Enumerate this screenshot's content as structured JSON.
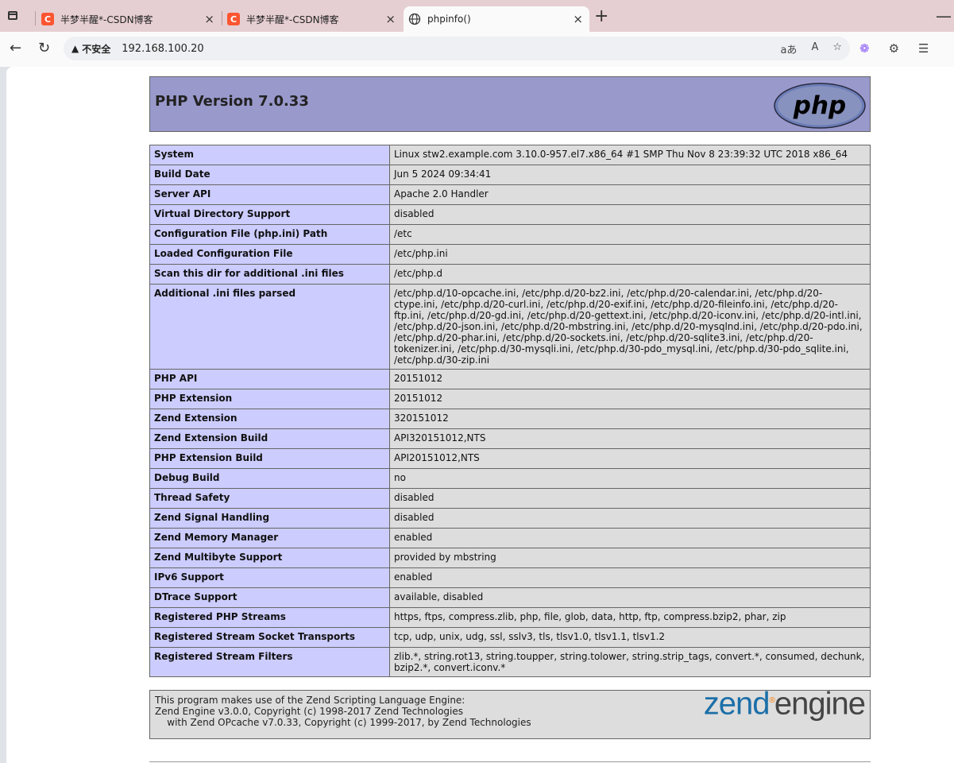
{
  "browser": {
    "tabs": [
      {
        "label": "半梦半醒*-CSDN博客",
        "icon": "csdn-icon",
        "favicon_text": "C",
        "active": false
      },
      {
        "label": "半梦半醒*-CSDN博客",
        "icon": "csdn-icon",
        "favicon_text": "C",
        "active": false
      },
      {
        "label": "phpinfo()",
        "icon": "globe-icon",
        "active": true
      }
    ],
    "address": {
      "security_label": "不安全",
      "url": "192.168.100.20"
    },
    "icons": {
      "back": "←",
      "refresh": "↻",
      "new_tab": "+",
      "close": "×",
      "minimize": "—",
      "read_aloud": "aあ",
      "reader": "A",
      "favorite": "☆",
      "copilot": "❁",
      "extensions": "⚙",
      "favorites_bar": "☰"
    }
  },
  "phpinfo": {
    "title": "PHP Version 7.0.33",
    "logo_text": "php",
    "rows": [
      {
        "key": "System",
        "value": "Linux stw2.example.com 3.10.0-957.el7.x86_64 #1 SMP Thu Nov 8 23:39:32 UTC 2018 x86_64"
      },
      {
        "key": "Build Date",
        "value": "Jun 5 2024 09:34:41"
      },
      {
        "key": "Server API",
        "value": "Apache 2.0 Handler"
      },
      {
        "key": "Virtual Directory Support",
        "value": "disabled"
      },
      {
        "key": "Configuration File (php.ini) Path",
        "value": "/etc"
      },
      {
        "key": "Loaded Configuration File",
        "value": "/etc/php.ini"
      },
      {
        "key": "Scan this dir for additional .ini files",
        "value": "/etc/php.d"
      },
      {
        "key": "Additional .ini files parsed",
        "value": "/etc/php.d/10-opcache.ini, /etc/php.d/20-bz2.ini, /etc/php.d/20-calendar.ini, /etc/php.d/20-ctype.ini, /etc/php.d/20-curl.ini, /etc/php.d/20-exif.ini, /etc/php.d/20-fileinfo.ini, /etc/php.d/20-ftp.ini, /etc/php.d/20-gd.ini, /etc/php.d/20-gettext.ini, /etc/php.d/20-iconv.ini, /etc/php.d/20-intl.ini, /etc/php.d/20-json.ini, /etc/php.d/20-mbstring.ini, /etc/php.d/20-mysqlnd.ini, /etc/php.d/20-pdo.ini, /etc/php.d/20-phar.ini, /etc/php.d/20-sockets.ini, /etc/php.d/20-sqlite3.ini, /etc/php.d/20-tokenizer.ini, /etc/php.d/30-mysqli.ini, /etc/php.d/30-pdo_mysql.ini, /etc/php.d/30-pdo_sqlite.ini, /etc/php.d/30-zip.ini"
      },
      {
        "key": "PHP API",
        "value": "20151012"
      },
      {
        "key": "PHP Extension",
        "value": "20151012"
      },
      {
        "key": "Zend Extension",
        "value": "320151012"
      },
      {
        "key": "Zend Extension Build",
        "value": "API320151012,NTS"
      },
      {
        "key": "PHP Extension Build",
        "value": "API20151012,NTS"
      },
      {
        "key": "Debug Build",
        "value": "no"
      },
      {
        "key": "Thread Safety",
        "value": "disabled"
      },
      {
        "key": "Zend Signal Handling",
        "value": "disabled"
      },
      {
        "key": "Zend Memory Manager",
        "value": "enabled"
      },
      {
        "key": "Zend Multibyte Support",
        "value": "provided by mbstring"
      },
      {
        "key": "IPv6 Support",
        "value": "enabled"
      },
      {
        "key": "DTrace Support",
        "value": "available, disabled"
      },
      {
        "key": "Registered PHP Streams",
        "value": "https, ftps, compress.zlib, php, file, glob, data, http, ftp, compress.bzip2, phar, zip"
      },
      {
        "key": "Registered Stream Socket Transports",
        "value": "tcp, udp, unix, udg, ssl, sslv3, tls, tlsv1.0, tlsv1.1, tlsv1.2"
      },
      {
        "key": "Registered Stream Filters",
        "value": "zlib.*, string.rot13, string.toupper, string.tolower, string.strip_tags, convert.*, consumed, dechunk, bzip2.*, convert.iconv.*"
      }
    ],
    "zend": {
      "lines": [
        "This program makes use of the Zend Scripting Language Engine:",
        "Zend Engine v3.0.0, Copyright (c) 1998-2017 Zend Technologies",
        "    with Zend OPcache v7.0.33, Copyright (c) 1999-2017, by Zend Technologies"
      ],
      "logo_zend": "zend",
      "logo_engine": "engine"
    }
  },
  "colors": {
    "header_bg": "#9999cc",
    "key_bg": "#ccccff",
    "value_bg": "#dddddd",
    "tabbar_bg": "#e6cfd2"
  }
}
